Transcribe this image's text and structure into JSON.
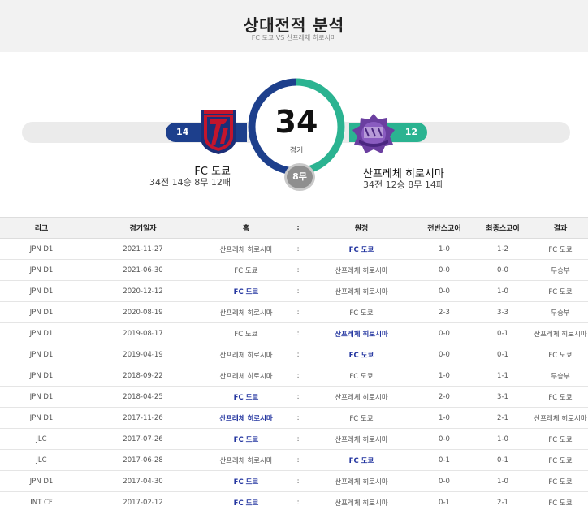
{
  "header": {
    "title": "상대전적 분석",
    "subtitle": "FC 도쿄 VS 산프레체 히로시마"
  },
  "summary": {
    "total_matches": "34",
    "total_label": "경기",
    "draws": "8무",
    "left_team": {
      "name": "FC 도쿄",
      "record": "34전 14승 8무 12패",
      "wins": "14",
      "color": "#1d3f8c"
    },
    "right_team": {
      "name": "산프레체 히로시마",
      "record": "34전 12승 8무 14패",
      "wins": "12",
      "color": "#2bb391"
    }
  },
  "table": {
    "headers": [
      "리그",
      "경기일자",
      "홈",
      ":",
      "원정",
      "전반스코어",
      "최종스코어",
      "결과"
    ],
    "rows": [
      {
        "league": "JPN D1",
        "date": "2021-11-27",
        "home": "산프레체 히로시마",
        "sep": ":",
        "away": "FC 도쿄",
        "half": "1-0",
        "final": "1-2",
        "result": "FC 도쿄",
        "winner": "away"
      },
      {
        "league": "JPN D1",
        "date": "2021-06-30",
        "home": "FC 도쿄",
        "sep": ":",
        "away": "산프레체 히로시마",
        "half": "0-0",
        "final": "0-0",
        "result": "무승부",
        "winner": "none"
      },
      {
        "league": "JPN D1",
        "date": "2020-12-12",
        "home": "FC 도쿄",
        "sep": ":",
        "away": "산프레체 히로시마",
        "half": "0-0",
        "final": "1-0",
        "result": "FC 도쿄",
        "winner": "home"
      },
      {
        "league": "JPN D1",
        "date": "2020-08-19",
        "home": "산프레체 히로시마",
        "sep": ":",
        "away": "FC 도쿄",
        "half": "2-3",
        "final": "3-3",
        "result": "무승부",
        "winner": "none"
      },
      {
        "league": "JPN D1",
        "date": "2019-08-17",
        "home": "FC 도쿄",
        "sep": ":",
        "away": "산프레체 히로시마",
        "half": "0-0",
        "final": "0-1",
        "result": "산프레체 히로시마",
        "winner": "away"
      },
      {
        "league": "JPN D1",
        "date": "2019-04-19",
        "home": "산프레체 히로시마",
        "sep": ":",
        "away": "FC 도쿄",
        "half": "0-0",
        "final": "0-1",
        "result": "FC 도쿄",
        "winner": "away"
      },
      {
        "league": "JPN D1",
        "date": "2018-09-22",
        "home": "산프레체 히로시마",
        "sep": ":",
        "away": "FC 도쿄",
        "half": "1-0",
        "final": "1-1",
        "result": "무승부",
        "winner": "none"
      },
      {
        "league": "JPN D1",
        "date": "2018-04-25",
        "home": "FC 도쿄",
        "sep": ":",
        "away": "산프레체 히로시마",
        "half": "2-0",
        "final": "3-1",
        "result": "FC 도쿄",
        "winner": "home"
      },
      {
        "league": "JPN D1",
        "date": "2017-11-26",
        "home": "산프레체 히로시마",
        "sep": ":",
        "away": "FC 도쿄",
        "half": "1-0",
        "final": "2-1",
        "result": "산프레체 히로시마",
        "winner": "home"
      },
      {
        "league": "JLC",
        "date": "2017-07-26",
        "home": "FC 도쿄",
        "sep": ":",
        "away": "산프레체 히로시마",
        "half": "0-0",
        "final": "1-0",
        "result": "FC 도쿄",
        "winner": "home"
      },
      {
        "league": "JLC",
        "date": "2017-06-28",
        "home": "산프레체 히로시마",
        "sep": ":",
        "away": "FC 도쿄",
        "half": "0-1",
        "final": "0-1",
        "result": "FC 도쿄",
        "winner": "away"
      },
      {
        "league": "JPN D1",
        "date": "2017-04-30",
        "home": "FC 도쿄",
        "sep": ":",
        "away": "산프레체 히로시마",
        "half": "0-0",
        "final": "1-0",
        "result": "FC 도쿄",
        "winner": "home"
      },
      {
        "league": "INT CF",
        "date": "2017-02-12",
        "home": "FC 도쿄",
        "sep": ":",
        "away": "산프레체 히로시마",
        "half": "0-1",
        "final": "2-1",
        "result": "FC 도쿄",
        "winner": "home"
      }
    ]
  }
}
